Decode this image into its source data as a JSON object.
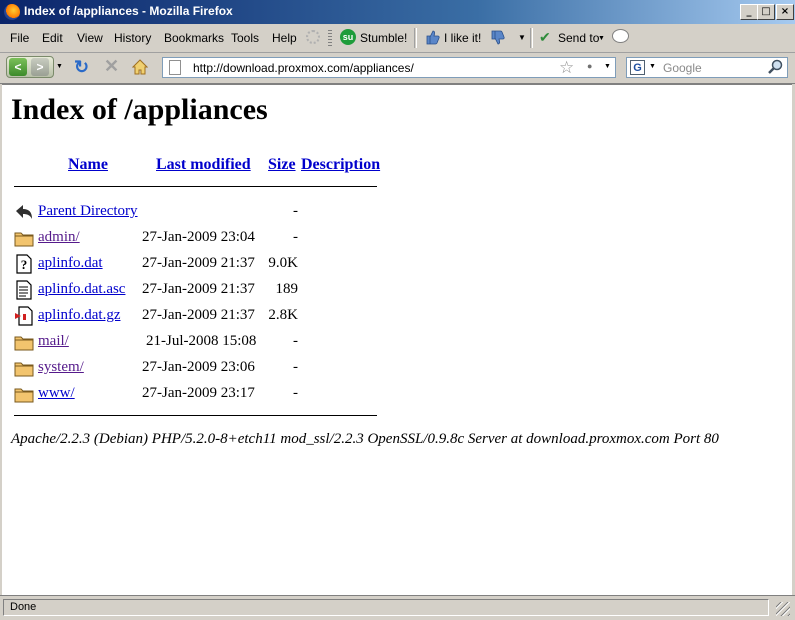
{
  "window": {
    "title": "Index of /appliances - Mozilla Firefox"
  },
  "menu": {
    "items": [
      {
        "label": "File"
      },
      {
        "label": "Edit"
      },
      {
        "label": "View"
      },
      {
        "label": "History"
      },
      {
        "label": "Bookmarks"
      },
      {
        "label": "Tools"
      },
      {
        "label": "Help"
      }
    ],
    "stumble_label": "Stumble!",
    "like_label": "I like it!",
    "sendto_label": "Send to"
  },
  "nav": {
    "url": "http://download.proxmox.com/appliances/",
    "search_placeholder": "Google",
    "search_engine_glyph": "G"
  },
  "page": {
    "title": "Index of /appliances",
    "headers": {
      "name": "Name",
      "modified": "Last modified",
      "size": "Size",
      "description": "Description"
    },
    "rows": [
      {
        "icon": "back-icon",
        "name": "Parent Directory",
        "modified": "",
        "size": "-",
        "visited": false
      },
      {
        "icon": "folder-icon",
        "name": "admin/",
        "modified": "27-Jan-2009 23:04",
        "size": "-",
        "visited": true
      },
      {
        "icon": "unknown-file-icon",
        "name": "aplinfo.dat",
        "modified": "27-Jan-2009 21:37",
        "size": "9.0K",
        "visited": false
      },
      {
        "icon": "text-file-icon",
        "name": "aplinfo.dat.asc",
        "modified": "27-Jan-2009 21:37",
        "size": "189",
        "visited": false
      },
      {
        "icon": "compressed-file-icon",
        "name": "aplinfo.dat.gz",
        "modified": "27-Jan-2009 21:37",
        "size": "2.8K",
        "visited": false
      },
      {
        "icon": "folder-icon",
        "name": "mail/",
        "modified": "21-Jul-2008 15:08",
        "size": "-",
        "visited": true
      },
      {
        "icon": "folder-icon",
        "name": "system/",
        "modified": "27-Jan-2009 23:06",
        "size": "-",
        "visited": true
      },
      {
        "icon": "folder-icon",
        "name": "www/",
        "modified": "27-Jan-2009 23:17",
        "size": "-",
        "visited": false
      }
    ],
    "server_signature": "Apache/2.2.3 (Debian) PHP/5.2.0-8+etch11 mod_ssl/2.2.3 OpenSSL/0.9.8c Server at download.proxmox.com Port 80"
  },
  "status": {
    "text": "Done"
  },
  "colors": {
    "link": "#0000cc",
    "visited": "#551a8b",
    "titlebar": "#0a246a"
  }
}
